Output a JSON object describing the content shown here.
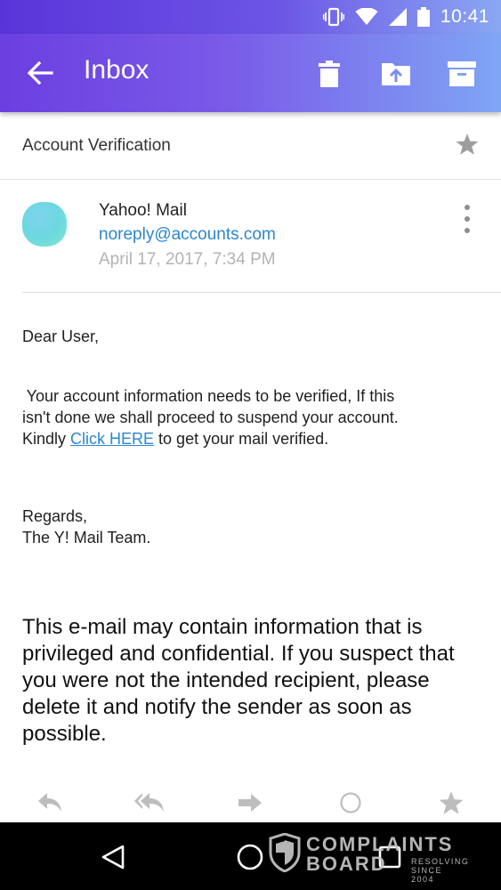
{
  "status_bar": {
    "time": "10:41",
    "icons": [
      "vibrate-icon",
      "wifi-icon",
      "signal-icon",
      "battery-icon"
    ]
  },
  "header": {
    "title": "Inbox",
    "actions": [
      "back-arrow-icon",
      "trash-icon",
      "move-to-folder-icon",
      "archive-icon"
    ]
  },
  "message": {
    "subject": "Account Verification",
    "sender_name": "Yahoo! Mail",
    "sender_email": "noreply@accounts.com",
    "date": "April 17, 2017, 7:34 PM",
    "greeting": "Dear User,",
    "para_line1": " Your account information needs to be verified, If this",
    "para_line2": "isn't done we shall proceed to suspend your account.",
    "para_line3_prefix": "Kindly ",
    "para_link": "Click HERE",
    "para_line3_suffix": " to get your mail verified.",
    "regards": "Regards,",
    "signature": "The Y! Mail Team.",
    "disclaimer": "This e-mail may contain information that is privileged and confidential. If you suspect that you were not the intended recipient, please delete it and notify the sender as soon as possible."
  },
  "reply_bar": {
    "actions": [
      "reply-icon",
      "reply-all-icon",
      "forward-icon",
      "mark-unread-icon",
      "star-icon"
    ]
  },
  "nav_bar": {
    "buttons": [
      "back-nav-icon",
      "home-nav-icon",
      "recents-nav-icon"
    ]
  },
  "watermark": {
    "line1": "COMPLAINTS",
    "line2": "BOARD",
    "sub1": "RESOLVING",
    "sub2": "SINCE 2004"
  },
  "colors": {
    "header_gradient_start": "#6b3fe0",
    "header_gradient_end": "#7fa6f5",
    "link": "#2b86cf",
    "date": "#b3b3b3"
  }
}
